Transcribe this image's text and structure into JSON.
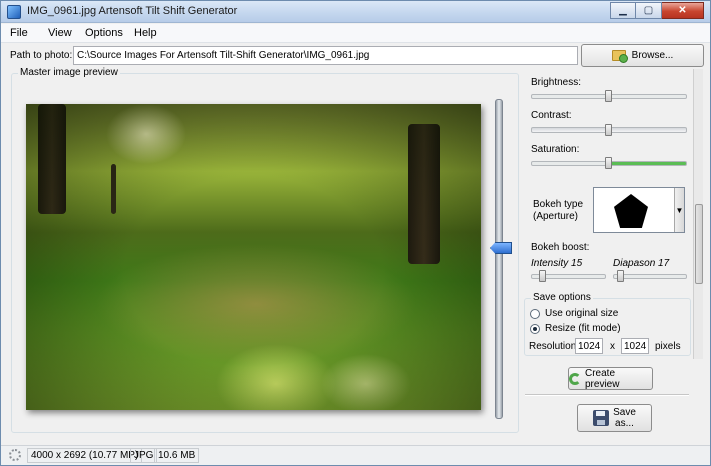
{
  "window": {
    "title": "IMG_0961.jpg Artensoft Tilt Shift Generator",
    "controls": {
      "minimize": "▁",
      "maximize": "▢",
      "close": "✕"
    }
  },
  "menu": {
    "items": [
      "File",
      "View",
      "Options",
      "Help"
    ]
  },
  "path": {
    "label": "Path to photo:",
    "value": "C:\\Source Images For Artensoft Tilt-Shift Generator\\IMG_0961.jpg",
    "browse_label": "Browse..."
  },
  "preview": {
    "title": "Master image preview"
  },
  "adjustments": {
    "brightness": {
      "label": "Brightness:",
      "level_pct": 50
    },
    "contrast": {
      "label": "Contrast:",
      "level_pct": 50
    },
    "saturation": {
      "label": "Saturation:",
      "level_pct": 50
    },
    "bokeh_type": {
      "label_line1": "Bokeh type",
      "label_line2": "(Aperture)",
      "selected": "pentagon"
    },
    "bokeh_boost": {
      "label": "Bokeh boost:",
      "intensity_label": "Intensity 15",
      "diapason_label": "Diapason 17"
    }
  },
  "save_options": {
    "title": "Save options",
    "options": [
      "Use original size",
      "Resize (fit mode)"
    ],
    "selected": "Resize (fit mode)",
    "resolution_label": "Resolution",
    "width": "1024",
    "x_label": "x",
    "height": "1024",
    "units": "pixels"
  },
  "buttons": {
    "create_preview": "Create preview",
    "save_as_line1": "Save",
    "save_as_line2": "as..."
  },
  "status": {
    "dimensions": "4000 x 2692 (10.77 MP)",
    "format": "JPG",
    "size": "10.6 MB"
  },
  "colors": {
    "accent_blue": "#2e6fd0",
    "saturation_green": "#5bbd55"
  }
}
